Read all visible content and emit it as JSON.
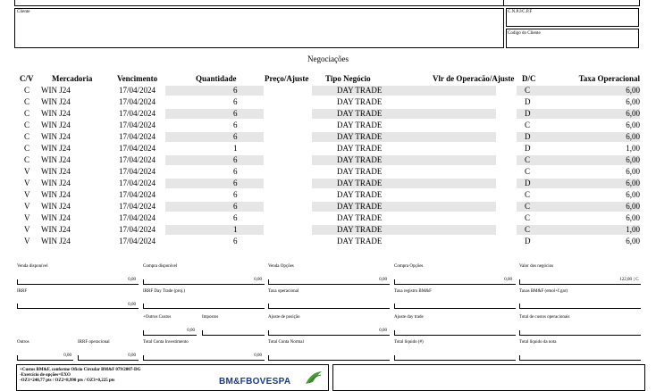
{
  "header": {
    "cliente_label": "Cliente",
    "cnpj_label": "C.N.P.J/C.P.F",
    "codigo_label": "Codigo do Cliente"
  },
  "section_title": "Negociações",
  "columns": {
    "cv": "C/V",
    "mercadoria": "Mercadoria",
    "vencimento": "Vencimento",
    "quantidade": "Quantidade",
    "preco": "Preço/Ajuste",
    "tipo": "Tipo Negócio",
    "vlr": "Vlr de Operacão/Ajuste",
    "dc": "D/C",
    "taxa": "Taxa Operacional"
  },
  "rows": [
    {
      "cv": "C",
      "mercadoria": "WIN J24",
      "vencimento": "17/04/2024",
      "quantidade": "6",
      "tipo": "DAY TRADE",
      "dc": "C",
      "taxa": "6,00"
    },
    {
      "cv": "C",
      "mercadoria": "WIN J24",
      "vencimento": "17/04/2024",
      "quantidade": "6",
      "tipo": "DAY TRADE",
      "dc": "D",
      "taxa": "6,00"
    },
    {
      "cv": "C",
      "mercadoria": "WIN J24",
      "vencimento": "17/04/2024",
      "quantidade": "6",
      "tipo": "DAY TRADE",
      "dc": "D",
      "taxa": "6,00"
    },
    {
      "cv": "C",
      "mercadoria": "WIN J24",
      "vencimento": "17/04/2024",
      "quantidade": "6",
      "tipo": "DAY TRADE",
      "dc": "C",
      "taxa": "6,00"
    },
    {
      "cv": "C",
      "mercadoria": "WIN J24",
      "vencimento": "17/04/2024",
      "quantidade": "6",
      "tipo": "DAY TRADE",
      "dc": "D",
      "taxa": "6,00"
    },
    {
      "cv": "C",
      "mercadoria": "WIN J24",
      "vencimento": "17/04/2024",
      "quantidade": "1",
      "tipo": "DAY TRADE",
      "dc": "D",
      "taxa": "1,00"
    },
    {
      "cv": "C",
      "mercadoria": "WIN J24",
      "vencimento": "17/04/2024",
      "quantidade": "6",
      "tipo": "DAY TRADE",
      "dc": "C",
      "taxa": "6,00"
    },
    {
      "cv": "V",
      "mercadoria": "WIN J24",
      "vencimento": "17/04/2024",
      "quantidade": "6",
      "tipo": "DAY TRADE",
      "dc": "C",
      "taxa": "6,00"
    },
    {
      "cv": "V",
      "mercadoria": "WIN J24",
      "vencimento": "17/04/2024",
      "quantidade": "6",
      "tipo": "DAY TRADE",
      "dc": "D",
      "taxa": "6,00"
    },
    {
      "cv": "V",
      "mercadoria": "WIN J24",
      "vencimento": "17/04/2024",
      "quantidade": "6",
      "tipo": "DAY TRADE",
      "dc": "C",
      "taxa": "6,00"
    },
    {
      "cv": "V",
      "mercadoria": "WIN J24",
      "vencimento": "17/04/2024",
      "quantidade": "6",
      "tipo": "DAY TRADE",
      "dc": "C",
      "taxa": "6,00"
    },
    {
      "cv": "V",
      "mercadoria": "WIN J24",
      "vencimento": "17/04/2024",
      "quantidade": "6",
      "tipo": "DAY TRADE",
      "dc": "C",
      "taxa": "6,00"
    },
    {
      "cv": "V",
      "mercadoria": "WIN J24",
      "vencimento": "17/04/2024",
      "quantidade": "1",
      "tipo": "DAY TRADE",
      "dc": "C",
      "taxa": "1,00"
    },
    {
      "cv": "V",
      "mercadoria": "WIN J24",
      "vencimento": "17/04/2024",
      "quantidade": "6",
      "tipo": "DAY TRADE",
      "dc": "D",
      "taxa": "6,00"
    }
  ],
  "summary": {
    "venda_disponivel": {
      "label": "Venda disponível",
      "value": "0,00"
    },
    "compra_disponivel": {
      "label": "Compra disponível",
      "value": "0,00"
    },
    "venda_opcoes": {
      "label": "Venda Opções",
      "value": "0,00"
    },
    "compra_opcoes": {
      "label": "Compra Opções",
      "value": "0,00"
    },
    "valor_negocios": {
      "label": "Valor dos negócios",
      "value": "122,00",
      "suffix": "| C"
    },
    "irrf": {
      "label": "IRRF"
    },
    "irrf_day_trade": {
      "label": "IRRF Day Trade (proj.)",
      "value": "0,00"
    },
    "taxa_operacional": {
      "label": "Taxa operacional"
    },
    "taxa_registro": {
      "label": "Taxa registro BM&F"
    },
    "taxas_bmf": {
      "label": "Taxas BM&F (emol+f.gar)"
    },
    "outros_custos": {
      "label": "+Outros Custos",
      "value": "0,00"
    },
    "impostos": {
      "label": "Impostos"
    },
    "ajuste_posicao": {
      "label": "Ajuste de posição",
      "value": "0,00"
    },
    "ajuste_day_trade": {
      "label": "Ajuste day trade"
    },
    "total_custos": {
      "label": "Total de custos operacionais"
    },
    "outros": {
      "label": "Outros",
      "value": "0,00"
    },
    "irrf_operacional": {
      "label": "IRRF operacional",
      "value": "0,00"
    },
    "total_conta_investimento": {
      "label": "Total Conta Investimento",
      "value": "0,00"
    },
    "total_conta_normal": {
      "label": "Total Conta Normal"
    },
    "total_liquido": {
      "label": "Total líquido (#)"
    },
    "total_liquido_nota": {
      "label": "Total líquido da nota"
    }
  },
  "footer": {
    "line1": "+Custos BM&F, conforme Ofício Circular BM&F 079/2007-DG",
    "line2": "-Exercício de opções=EXO",
    "line3": "-OZ1=240,77 pts / OZ2=8,990 pts / OZ3=0,225 pts",
    "logo_text": "BM&FBOVESPA"
  }
}
